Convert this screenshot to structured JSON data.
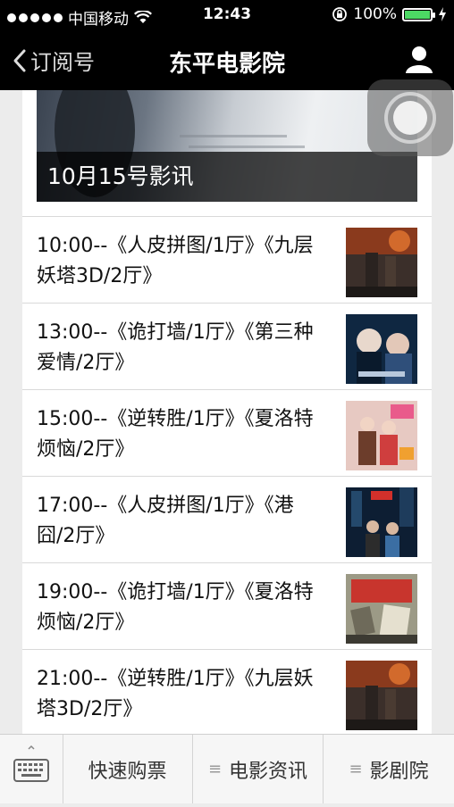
{
  "status_bar": {
    "carrier": "中国移动",
    "time": "12:43",
    "battery": "100%",
    "battery_level": 1.0
  },
  "nav": {
    "back_label": "订阅号",
    "title": "东平电影院"
  },
  "banner": {
    "caption": "10月15号影讯"
  },
  "schedule": [
    {
      "text": "10:00--《人皮拼图/1厅》《九层妖塔3D/2厅》"
    },
    {
      "text": "13:00--《诡打墙/1厅》《第三种爱情/2厅》"
    },
    {
      "text": "15:00--《逆转胜/1厅》《夏洛特烦恼/2厅》"
    },
    {
      "text": "17:00--《人皮拼图/1厅》《港囧/2厅》"
    },
    {
      "text": "19:00--《诡打墙/1厅》《夏洛特烦恼/2厅》"
    },
    {
      "text": "21:00--《逆转胜/1厅》《九层妖塔3D/2厅》"
    }
  ],
  "bottom_bar": {
    "tabs": [
      {
        "label": "快速购票"
      },
      {
        "label": "电影资讯"
      },
      {
        "label": "影剧院"
      }
    ]
  },
  "colors": {
    "status_bg": "#000000",
    "battery_green": "#4cd964",
    "caption_bg": "#000000"
  }
}
